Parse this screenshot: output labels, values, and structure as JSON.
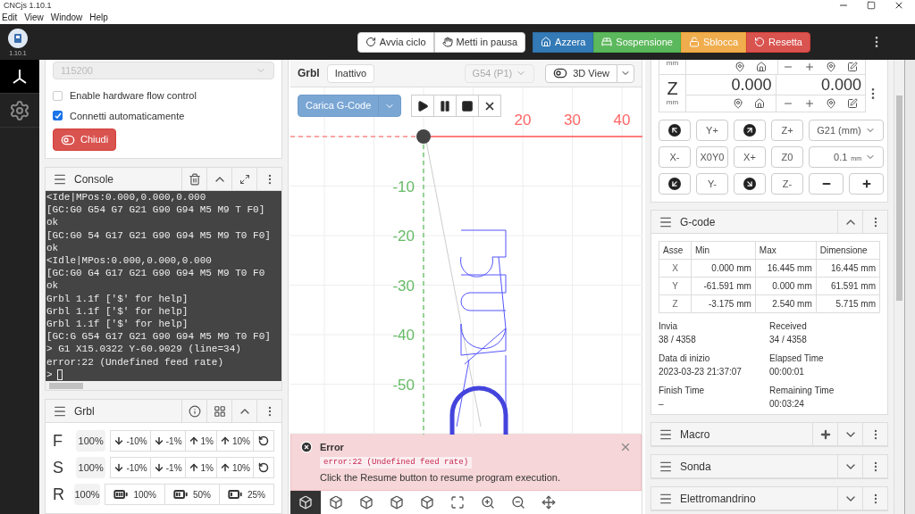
{
  "window": {
    "title": "CNCjs 1.10.1"
  },
  "menu": [
    "Edit",
    "View",
    "Window",
    "Help"
  ],
  "header": {
    "version": "1.10.1",
    "buttons": [
      {
        "label": "Avvia ciclo",
        "kind": "default"
      },
      {
        "label": "Metti in pausa",
        "kind": "default"
      },
      {
        "label": "Azzera",
        "kind": "primary"
      },
      {
        "label": "Sospensione",
        "kind": "success"
      },
      {
        "label": "Sblocca",
        "kind": "warning"
      },
      {
        "label": "Resetta",
        "kind": "danger"
      }
    ]
  },
  "sidebar": {
    "items": [
      {
        "selected": true
      },
      {
        "selected": false
      }
    ]
  },
  "connection": {
    "baud_rate": {
      "value": "115200",
      "disabled": true
    },
    "options": [
      {
        "label": "Enable hardware flow control",
        "checked": false
      },
      {
        "label": "Connetti automaticamente",
        "checked": true
      }
    ],
    "close_button": "Chiudi"
  },
  "console": {
    "title": "Console",
    "lines": [
      "<Ide|MPos:0.000,0.000,0.000",
      "[GC:G0 G54 G7 G21 G90 G94 M5 M9 T F0]",
      "ok",
      "[GC:G0 54 G17 G21 G90 G94 M5 M9 T0 F0]",
      "ok",
      "<Idle|MPos:0.000,0.000,0.000",
      "[GC:G0 G4 G17 G21 G90 G94 M5 M9 T0 F0",
      "ok",
      "Grbl 1.1f ['$' for help]",
      "Grbl 1.1f ['$' for help]",
      "Grbl 1.1f ['$' for help]",
      "[GC:G G54 G17 G21 G90 G94 M5 M9 T0 F0]",
      "> G1 X15.0322 Y-60.9029 (line=34)",
      "error:22 (Undefined feed rate)",
      ">"
    ]
  },
  "grbl": {
    "title": "Grbl",
    "overrides": [
      {
        "axis": "F",
        "value": "100%",
        "kind": "steps",
        "buttons": [
          "-10%",
          "-1%",
          "1%",
          "10%"
        ]
      },
      {
        "axis": "S",
        "value": "100%",
        "kind": "steps",
        "buttons": [
          "-10%",
          "-1%",
          "1%",
          "10%"
        ]
      },
      {
        "axis": "R",
        "value": "100%",
        "kind": "rapid",
        "buttons": [
          "100%",
          "50%",
          "25%"
        ]
      }
    ]
  },
  "visualizer": {
    "controller": "Grbl",
    "state": "Inattivo",
    "wcs": {
      "label": "G54 (P1)",
      "disabled": true
    },
    "view": "3D View",
    "load_button": "Carica G-Code",
    "x_ticks": [
      "20",
      "30",
      "40"
    ],
    "y_ticks": [
      "-10",
      "-20",
      "-30",
      "-40",
      "-50"
    ],
    "error": {
      "title": "Error",
      "code": "error:22 (Undefined feed rate)",
      "message": "Click the Resume button to resume program execution."
    },
    "view_tools": [
      {
        "selected": true
      },
      {
        "selected": false
      },
      {
        "selected": false
      },
      {
        "selected": false
      },
      {
        "selected": false
      },
      {
        "selected": false
      },
      {
        "selected": false
      },
      {
        "selected": false
      },
      {
        "selected": false
      }
    ]
  },
  "axes": {
    "top_unit": "mm",
    "axis": {
      "name": "Z",
      "unit": "mm",
      "machine": "0.000",
      "work": "0.000"
    },
    "jog": [
      {
        "kind": "icon"
      },
      {
        "kind": "text",
        "label": "Y+"
      },
      {
        "kind": "icon"
      },
      {
        "kind": "text",
        "label": "Z+"
      },
      {
        "kind": "text",
        "label": "X-"
      },
      {
        "kind": "text",
        "label": "X0Y0"
      },
      {
        "kind": "text",
        "label": "X+"
      },
      {
        "kind": "text",
        "label": "Z0"
      },
      {
        "kind": "icon"
      },
      {
        "kind": "text",
        "label": "Y-"
      },
      {
        "kind": "icon"
      },
      {
        "kind": "text",
        "label": "Z-"
      }
    ],
    "units": "G21 (mm)",
    "step": {
      "value": "0.1",
      "unit": "mm"
    }
  },
  "gcode": {
    "title": "G-code",
    "columns": [
      "Asse",
      "Min",
      "Max",
      "Dimensione"
    ],
    "rows": [
      [
        "X",
        "0.000 mm",
        "16.445 mm",
        "16.445 mm"
      ],
      [
        "Y",
        "-61.591 mm",
        "0.000 mm",
        "61.591 mm"
      ],
      [
        "Z",
        "-3.175 mm",
        "2.540 mm",
        "5.715 mm"
      ]
    ],
    "stats": [
      {
        "label": "Invia",
        "value": "38 / 4358"
      },
      {
        "label": "Received",
        "value": "34 / 4358"
      },
      {
        "label": "Data di inizio",
        "value": "2023-03-23 21:37:07"
      },
      {
        "label": "Elapsed Time",
        "value": "00:00:01"
      },
      {
        "label": "Finish Time",
        "value": "–"
      },
      {
        "label": "Remaining Time",
        "value": "00:03:24"
      }
    ]
  },
  "collapsed_panels": [
    {
      "title": "Macro",
      "add_button": true,
      "expanded": false
    },
    {
      "title": "Sonda",
      "add_button": false,
      "expanded": false
    },
    {
      "title": "Elettromandrino",
      "add_button": false,
      "expanded": false
    }
  ]
}
